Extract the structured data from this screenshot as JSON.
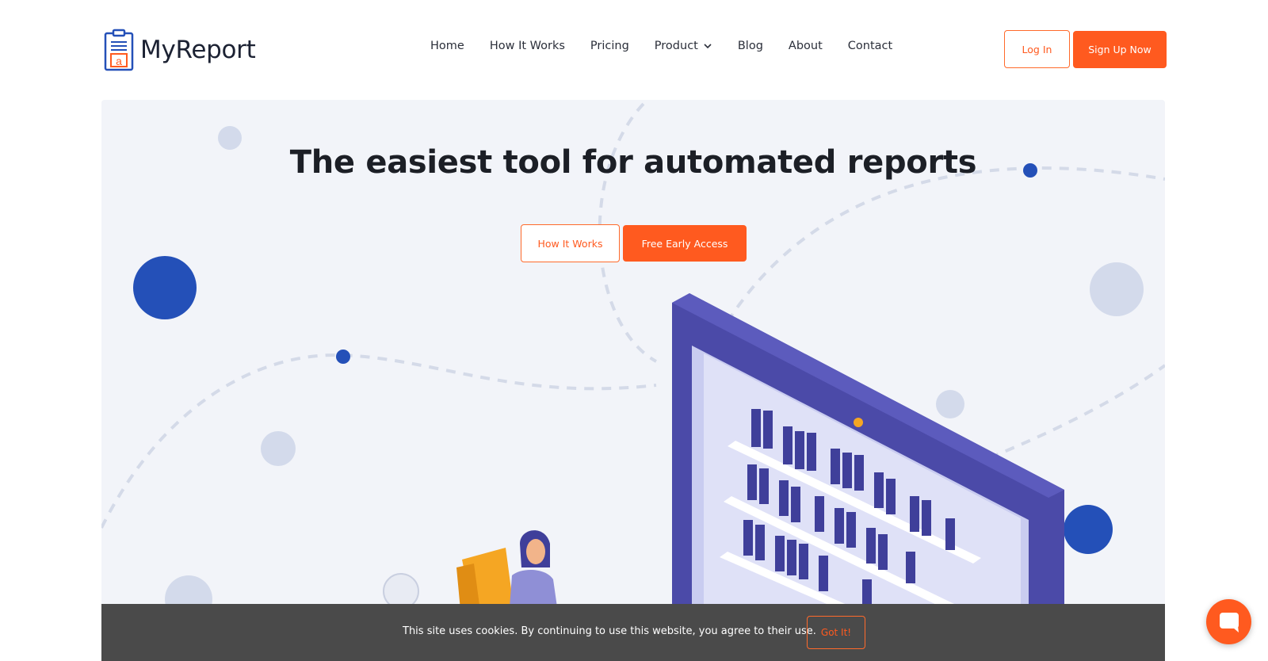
{
  "brand": {
    "name": "MyReport",
    "logo_icon": "clipboard-report-icon",
    "accent": "#ff5a1f",
    "primary_blue": "#2450b8"
  },
  "nav": {
    "items": [
      {
        "label": "Home"
      },
      {
        "label": "How It Works"
      },
      {
        "label": "Pricing"
      },
      {
        "label": "Product",
        "has_dropdown": true
      },
      {
        "label": "Blog"
      },
      {
        "label": "About"
      },
      {
        "label": "Contact"
      }
    ]
  },
  "auth": {
    "login_label": "Log In",
    "signup_label": "Sign Up Now"
  },
  "hero": {
    "title": "The easiest tool for automated reports",
    "secondary_cta": "How It Works",
    "primary_cta": "Free Early Access",
    "illustration": "isometric-monitor-with-bookshelves-and-woman-illustration"
  },
  "cookie": {
    "message": "This site uses cookies. By continuing to use this website, you agree to their use.",
    "button_label": "Got It!"
  },
  "chat": {
    "icon": "chat-bubble-icon"
  }
}
